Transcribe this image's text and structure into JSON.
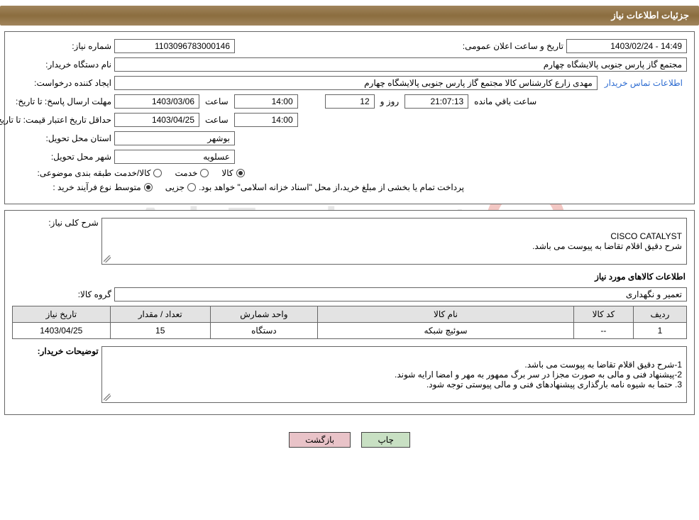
{
  "header": {
    "title": "جزئیات اطلاعات نیاز"
  },
  "watermark": "AriaTender.net",
  "fields": {
    "need_no_label": "شماره نیاز:",
    "need_no": "1103096783000146",
    "announce_label": "تاریخ و ساعت اعلان عمومی:",
    "announce_value": "14:49 - 1403/02/24",
    "buyer_org_label": "نام دستگاه خریدار:",
    "buyer_org": "مجتمع گاز پارس جنوبی  پالایشگاه چهارم",
    "requester_label": "ایجاد کننده درخواست:",
    "requester": "مهدی زارع کارشناس کالا مجتمع گاز پارس جنوبی  پالایشگاه چهارم",
    "buyer_contact_link": "اطلاعات تماس خریدار",
    "reply_deadline_label": "مهلت ارسال پاسخ:  تا تاریخ:",
    "reply_deadline_date": "1403/03/06",
    "time_label": "ساعت",
    "reply_deadline_time": "14:00",
    "days_value": "12",
    "days_and_label": "روز و",
    "countdown": "21:07:13",
    "remaining_label": "ساعت باقي مانده",
    "price_validity_label": "حداقل تاریخ اعتبار قیمت: تا تاریخ:",
    "price_validity_date": "1403/04/25",
    "price_validity_time": "14:00",
    "province_label": "استان محل تحویل:",
    "province": "بوشهر",
    "city_label": "شهر محل تحویل:",
    "city": "عسلویه",
    "category_label": "طبقه بندی موضوعی:",
    "cat_kala": "کالا",
    "cat_khadamat": "خدمت",
    "cat_kalakhadmat": "کالا/خدمت",
    "purchase_type_label": "نوع فرآیند خرید :",
    "pt_partial": "جزیی",
    "pt_medium": "متوسط",
    "purchase_note": "پرداخت تمام یا بخشی از مبلغ خرید،از محل \"اسناد خزانه اسلامی\" خواهد بود.",
    "general_desc_label": "شرح کلی نیاز:",
    "general_desc": "CISCO CATALYST\nشرح دقیق اقلام تقاضا به پیوست می باشد.",
    "items_section_title": "اطلاعات کالاهای مورد نیاز",
    "group_label": "گروه کالا:",
    "group_value": "تعمیر و نگهداری",
    "table": {
      "headers": {
        "row": "ردیف",
        "code": "کد کالا",
        "name": "نام کالا",
        "unit": "واحد شمارش",
        "qty": "تعداد / مقدار",
        "date": "تاریخ نیاز"
      },
      "rows": [
        {
          "row": "1",
          "code": "--",
          "name": "سوئیچ شبکه",
          "unit": "دستگاه",
          "qty": "15",
          "date": "1403/04/25"
        }
      ]
    },
    "buyer_notes_label": "توضیحات خریدار:",
    "buyer_notes": "1-شرح دقیق اقلام تقاضا به پیوست می باشد.\n2-پیشنهاد فنی و مالی به صورت مجزا در سر برگ ممهور به مهر و امضا ارایه شوند.\n3. حتما به شیوه نامه بارگذاری پیشنهادهای فنی و مالی پیوستی توجه شود."
  },
  "buttons": {
    "print": "چاپ",
    "back": "بازگشت"
  }
}
